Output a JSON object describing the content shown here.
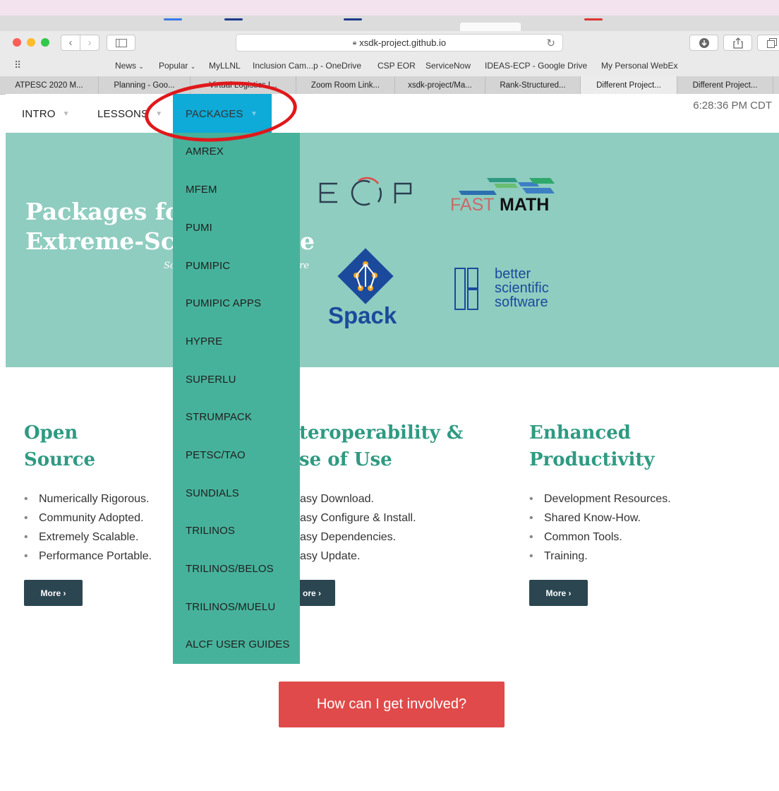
{
  "browser": {
    "url": "xsdk-project.github.io",
    "bookmarks": [
      "News",
      "Popular",
      "MyLLNL",
      "Inclusion Cam...p - OneDrive",
      "CSP EOR",
      "ServiceNow",
      "IDEAS-ECP - Google Drive",
      "My Personal WebEx"
    ],
    "tabs": [
      "ATPESC 2020 M...",
      "Planning - Goo...",
      "Virtual Logistics I...",
      "Zoom Room Link...",
      "xsdk-project/Ma...",
      "Rank-Structured...",
      "Different Project...",
      "Different Project..."
    ],
    "active_tab_index": 6,
    "colors": {
      "close": "#fc5f57",
      "minimize": "#fdbc2e",
      "zoom": "#34c84a"
    }
  },
  "nav": {
    "items": [
      "INTRO",
      "LESSONS",
      "PACKAGES"
    ],
    "time": "6:28:36 PM CDT"
  },
  "hero": {
    "title_line1": "Packages fo",
    "title_line2": "Extreme-Sc",
    "title_tail": "e",
    "subtitle_left": "Sc",
    "subtitle_right": "re",
    "logos": {
      "ecp": "E C P",
      "fastmath_fast": "FAST",
      "fastmath_math": "MATH",
      "spack": "Spack",
      "bss": [
        "better",
        "scientific",
        "software"
      ]
    }
  },
  "dropdown": {
    "items": [
      "AMREX",
      "MFEM",
      "PUMI",
      "PUMIPIC",
      "PUMIPIC APPS",
      "HYPRE",
      "SUPERLU",
      "STRUMPACK",
      "PETSC/TAO",
      "SUNDIALS",
      "TRILINOS",
      "TRILINOS/BELOS",
      "TRILINOS/MUELU",
      "ALCF USER GUIDES"
    ]
  },
  "columns": [
    {
      "title_line1": "Open",
      "title_line2": "Source",
      "bullets": [
        "Numerically Rigorous.",
        "Community Adopted.",
        "Extremely Scalable.",
        "Performance Portable."
      ],
      "more": "More ›"
    },
    {
      "title_line1": "teroperability &",
      "title_line2": "se of Use",
      "bullets": [
        "asy Download.",
        "asy Configure & Install.",
        "asy Dependencies.",
        "asy Update."
      ],
      "more": "ore ›"
    },
    {
      "title_line1": "Enhanced",
      "title_line2": "Productivity",
      "bullets": [
        "Development Resources.",
        "Shared Know-How.",
        "Common Tools.",
        "Training."
      ],
      "more": "More ›"
    }
  ],
  "cta": "How can I get involved?"
}
